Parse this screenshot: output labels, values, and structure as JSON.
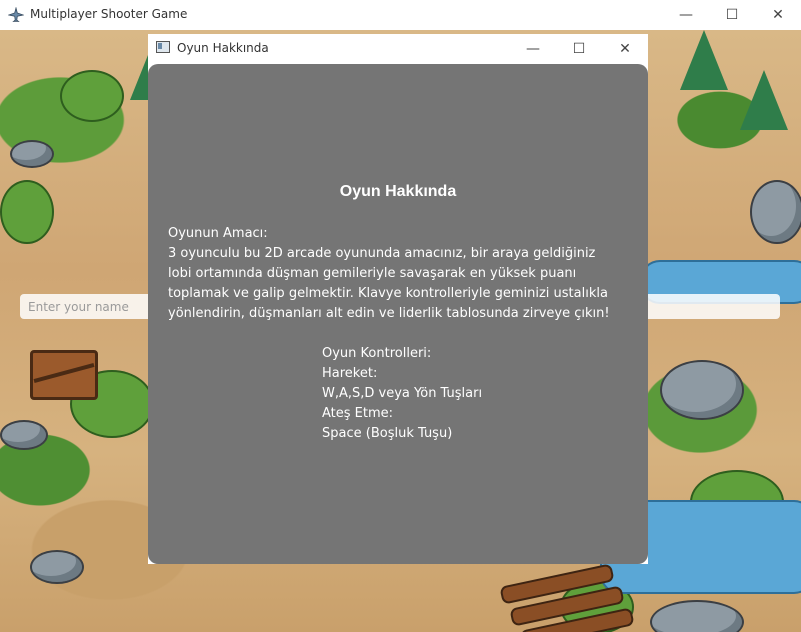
{
  "main_window": {
    "title": "Multiplayer Shooter Game",
    "icon": "plane-icon",
    "controls": {
      "minimize": "—",
      "maximize": "☐",
      "close": "✕"
    }
  },
  "name_input": {
    "placeholder": "Enter your name",
    "value": ""
  },
  "dialog": {
    "title": "Oyun Hakkında",
    "icon": "window-icon",
    "controls": {
      "minimize": "—",
      "maximize": "☐",
      "close": "✕"
    },
    "heading": "Oyun Hakkında",
    "aim_title": "Oyunun Amacı:",
    "aim_text": "3 oyunculu bu 2D arcade oyununda amacınız, bir araya geldiğiniz lobi ortamında düşman gemileriyle savaşarak en yüksek puanı toplamak ve galip gelmektir. Klavye kontrolleriyle geminizi ustalıkla yönlendirin, düşmanları alt edin ve liderlik tablosunda zirveye çıkın!",
    "controls_title": "Oyun Kontrolleri:",
    "move_label": "Hareket:",
    "move_keys": "W,A,S,D veya Yön Tuşları",
    "fire_label": "Ateş Etme:",
    "fire_key": "Space (Boşluk Tuşu)"
  },
  "colors": {
    "panel": "#757575",
    "titlebar": "#ffffff"
  }
}
